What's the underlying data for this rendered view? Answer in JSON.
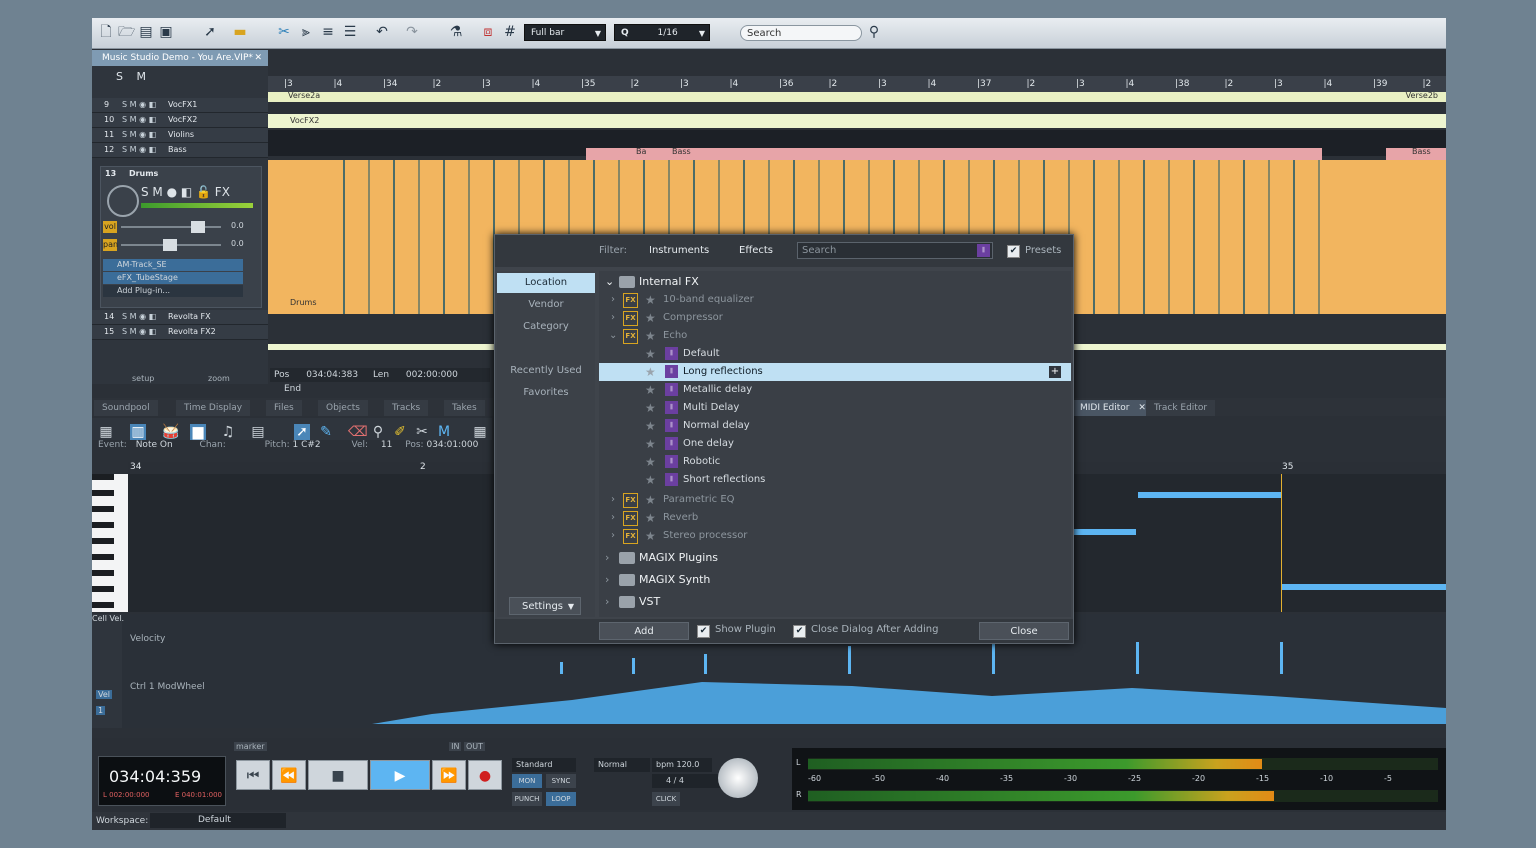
{
  "toolbar": {
    "quantize_mode": "Full bar",
    "quantize_value": "1/16",
    "q_label": "Q",
    "search_placeholder": "Search"
  },
  "project": {
    "title": "Music Studio Demo - You Are.VIP*"
  },
  "track_header": {
    "solo": "S",
    "mute": "M"
  },
  "tracks": [
    {
      "num": "9",
      "name": "VocFX1"
    },
    {
      "num": "10",
      "name": "VocFX2"
    },
    {
      "num": "11",
      "name": "Violins"
    },
    {
      "num": "12",
      "name": "Bass"
    }
  ],
  "drum_track": {
    "num": "13",
    "name": "Drums",
    "vol_label": "vol",
    "vol_value": "0.0",
    "pan_label": "pan",
    "pan_value": "0.0",
    "plugins": [
      "AM-Track_SE",
      "eFX_TubeStage",
      "Add Plug-in..."
    ]
  },
  "tracks_lower": [
    {
      "num": "14",
      "name": "Revolta FX"
    },
    {
      "num": "15",
      "name": "Revolta FX2"
    }
  ],
  "setup_zoom": {
    "setup": "setup",
    "zoom": "zoom"
  },
  "ruler": {
    "marks": [
      "3",
      "4",
      "34",
      "2",
      "3",
      "4",
      "35",
      "2",
      "3",
      "4",
      "36",
      "2",
      "3",
      "4",
      "37",
      "2",
      "3",
      "4",
      "38",
      "2",
      "3",
      "4",
      "39",
      "2"
    ]
  },
  "clips": {
    "verse2a": "Verse2a",
    "verse2b": "Verse2b",
    "vocfx2": "VocFX2",
    "bass1": "Ba",
    "bass2": "Bass",
    "bass3": "Bass",
    "drums": "Drums"
  },
  "position_bar": {
    "pos_label": "Pos",
    "pos_value": "034:04:383",
    "len_label": "Len",
    "len_value": "002:00:000",
    "end_label": "End"
  },
  "dialog": {
    "filter_label": "Filter:",
    "filter_instruments": "Instruments",
    "filter_effects": "Effects",
    "search_placeholder": "Search",
    "presets_label": "Presets",
    "side": [
      "Location",
      "Vendor",
      "Category",
      "Recently Used",
      "Favorites"
    ],
    "settings_label": "Settings",
    "root": "Internal FX",
    "effects": [
      "10-band equalizer",
      "Compressor",
      "Echo"
    ],
    "echo_presets": [
      "Default",
      "Long reflections",
      "Metallic delay",
      "Multi Delay",
      "Normal delay",
      "One delay",
      "Robotic",
      "Short reflections"
    ],
    "effects_after": [
      "Parametric EQ",
      "Reverb",
      "Stereo processor"
    ],
    "folders": [
      "MAGIX Plugins",
      "MAGIX Synth",
      "VST"
    ],
    "add_label": "Add",
    "show_plugin_label": "Show Plugin",
    "close_after_label": "Close Dialog After Adding",
    "close_label": "Close",
    "fx_tag": "FX"
  },
  "lower_tabs": [
    "Soundpool",
    "Time Display",
    "Files",
    "Objects",
    "Tracks",
    "Takes"
  ],
  "right_tabs": [
    "MIDI Editor",
    "Track Editor"
  ],
  "midi_info": {
    "event_label": "Event:",
    "event_value": "Note On",
    "chan_label": "Chan:",
    "pitch_label": "Pitch:",
    "pitch_value": "1 C#2",
    "vel_label": "Vel:",
    "vel_value": "11",
    "pos_label": "Pos:",
    "pos_value": "034:01:000"
  },
  "midi_ruler": [
    "34",
    "2",
    "35"
  ],
  "controller": {
    "velocity": "Velocity",
    "modwheel": "Ctrl 1 ModWheel",
    "cell_vel": "Cell Vel.",
    "vel": "Vel",
    "one": "1"
  },
  "transport": {
    "time": "034:04:359",
    "range_start": "L 002:00:000",
    "range_end": "E 040:01:000",
    "marker_label": "marker",
    "in_label": "IN",
    "out_label": "OUT",
    "mode": "Standard",
    "mon": "MON",
    "sync": "SYNC",
    "punch": "PUNCH",
    "loop": "LOOP",
    "tempo_mode": "Normal",
    "bpm": "bpm 120.0",
    "signature": "4 / 4",
    "click": "CLICK",
    "meter_labels": [
      "-60",
      "-50",
      "-40",
      "-35",
      "-30",
      "-25",
      "-20",
      "-15",
      "-10",
      "-5"
    ],
    "ch_l": "L",
    "ch_r": "R",
    "meter_l": 0.72,
    "meter_r": 0.74
  },
  "status": {
    "workspace_label": "Workspace:",
    "workspace_value": "Default"
  }
}
